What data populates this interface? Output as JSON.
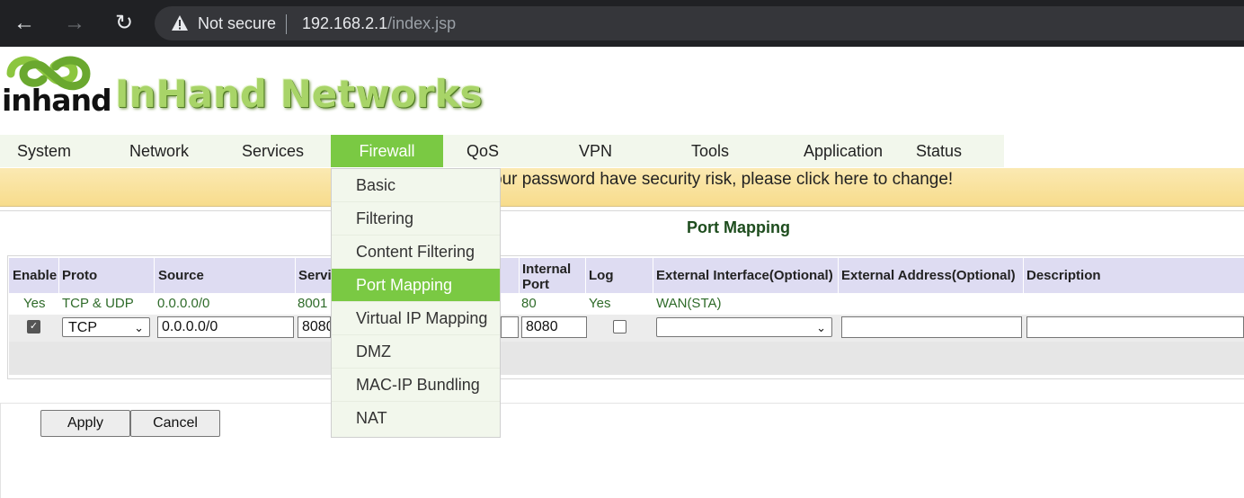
{
  "browser": {
    "security_label": "Not secure",
    "url_host": "192.168.2.1",
    "url_path": "/index.jsp"
  },
  "header": {
    "logo_text": "inhand",
    "brand_title": "InHand Networks"
  },
  "menu": {
    "items": [
      "System",
      "Network",
      "Services",
      "Firewall",
      "QoS",
      "VPN",
      "Tools",
      "Application",
      "Status"
    ],
    "active": "Firewall"
  },
  "warning": {
    "text": "our password have security risk, please click here to change!"
  },
  "firewall_menu": {
    "items": [
      "Basic",
      "Filtering",
      "Content Filtering",
      "Port Mapping",
      "Virtual IP Mapping",
      "DMZ",
      "MAC-IP Bundling",
      "NAT"
    ],
    "active": "Port Mapping"
  },
  "page": {
    "title": "Port Mapping"
  },
  "table": {
    "columns": {
      "enable": "Enable",
      "proto": "Proto",
      "source": "Source",
      "service": "Servi",
      "internal_port_line1": "Internal",
      "internal_port_line2": "Port",
      "log": "Log",
      "external_interface": "External Interface(Optional)",
      "external_address": "External Address(Optional)",
      "description": "Description"
    },
    "row": {
      "enable": "Yes",
      "proto": "TCP & UDP",
      "source": "0.0.0.0/0",
      "service": "8001",
      "internal_port": "80",
      "log": "Yes",
      "external_interface": "WAN(STA)"
    },
    "edit": {
      "enable_checked": true,
      "proto": "TCP",
      "source": "0.0.0.0/0",
      "service": "8080",
      "internal_port": "8080",
      "log_checked": false,
      "external_interface": "",
      "external_address": "",
      "description": ""
    }
  },
  "buttons": {
    "apply": "Apply",
    "cancel": "Cancel"
  },
  "colors": {
    "menu_active": "#7ac943",
    "menu_bg": "#f2f7ec",
    "table_header": "#dedcf2",
    "row_text": "#2f6b2a",
    "warning_bg": "#f7dc8c"
  }
}
